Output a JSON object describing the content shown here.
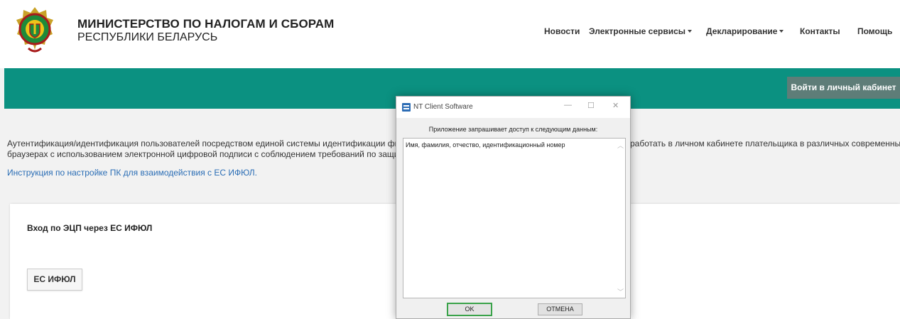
{
  "header": {
    "title_line1": "МИНИСТЕРСТВО ПО НАЛОГАМ И СБОРАМ",
    "title_line2": "РЕСПУБЛИКИ БЕЛАРУСЬ",
    "nav": {
      "news": "Новости",
      "eservices": "Электронные сервисы",
      "declaring": "Декларирование",
      "contacts": "Контакты",
      "help": "Помощь"
    }
  },
  "band": {
    "cabinet_button": "Войти в личный кабинет"
  },
  "content": {
    "desc_line1_left": "Аутентификация/идентификация пользователей посредством единой системы идентификации физ",
    "desc_line2_left": "браузерах с использованием электронной цифровой подписи с соблюдением требований по защит",
    "desc_line1_right": "работать в личном кабинете плательщика в различных современных",
    "instruction_link": "Инструкция по настройке ПК для взаимодействия с ЕС ИФЮЛ.",
    "card_title": "Вход по ЭЦП через ЕС ИФЮЛ",
    "card_button": "ЕС ИФЮЛ"
  },
  "dialog": {
    "title": "NT Client Software",
    "prompt": "Приложение запрашивает доступ к следующим данным:",
    "requested_data": "Имя, фамилия, отчество, идентификационный номер",
    "ok": "OK",
    "cancel": "ОТМЕНА"
  },
  "colors": {
    "teal": "#0b9181",
    "cabinet_button": "#5e7d78",
    "link": "#2a6db5",
    "ok_focus": "#3aa34a"
  }
}
